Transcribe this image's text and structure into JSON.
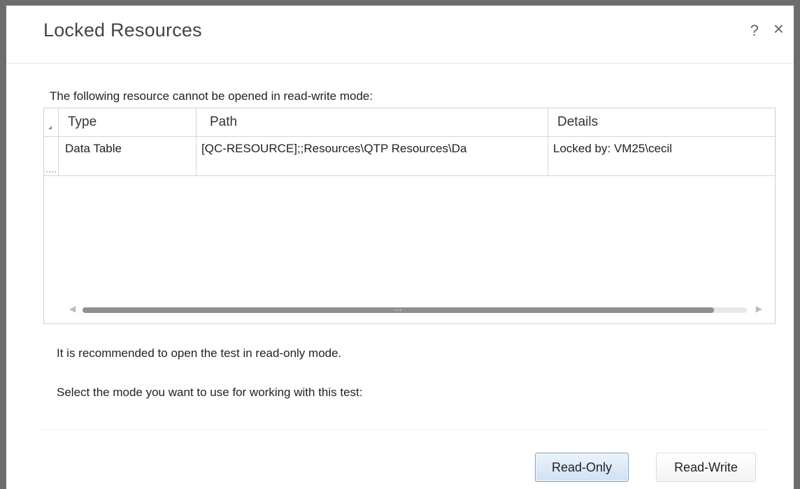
{
  "dialog": {
    "title": "Locked Resources",
    "help_label": "?",
    "close_label": "×"
  },
  "intro_text": "The following resource cannot be opened in read-write mode:",
  "table": {
    "columns": [
      "Type",
      "Path",
      "Details"
    ],
    "rows": [
      {
        "type": "Data Table",
        "path": "[QC-RESOURCE];;Resources\\QTP Resources\\Da",
        "details": "Locked by: VM25\\cecil"
      }
    ],
    "hscroll_fraction": 0.95
  },
  "recommendation_text": "It is recommended to open the test in read-only mode.",
  "select_mode_text": "Select the mode you want to use for working with this test:",
  "buttons": {
    "read_only": "Read-Only",
    "read_write": "Read-Write"
  },
  "colors": {
    "primary_button_bg": "#cfe1f3",
    "primary_button_border": "#7aa2c8",
    "window_border": "#6d6d6d"
  }
}
